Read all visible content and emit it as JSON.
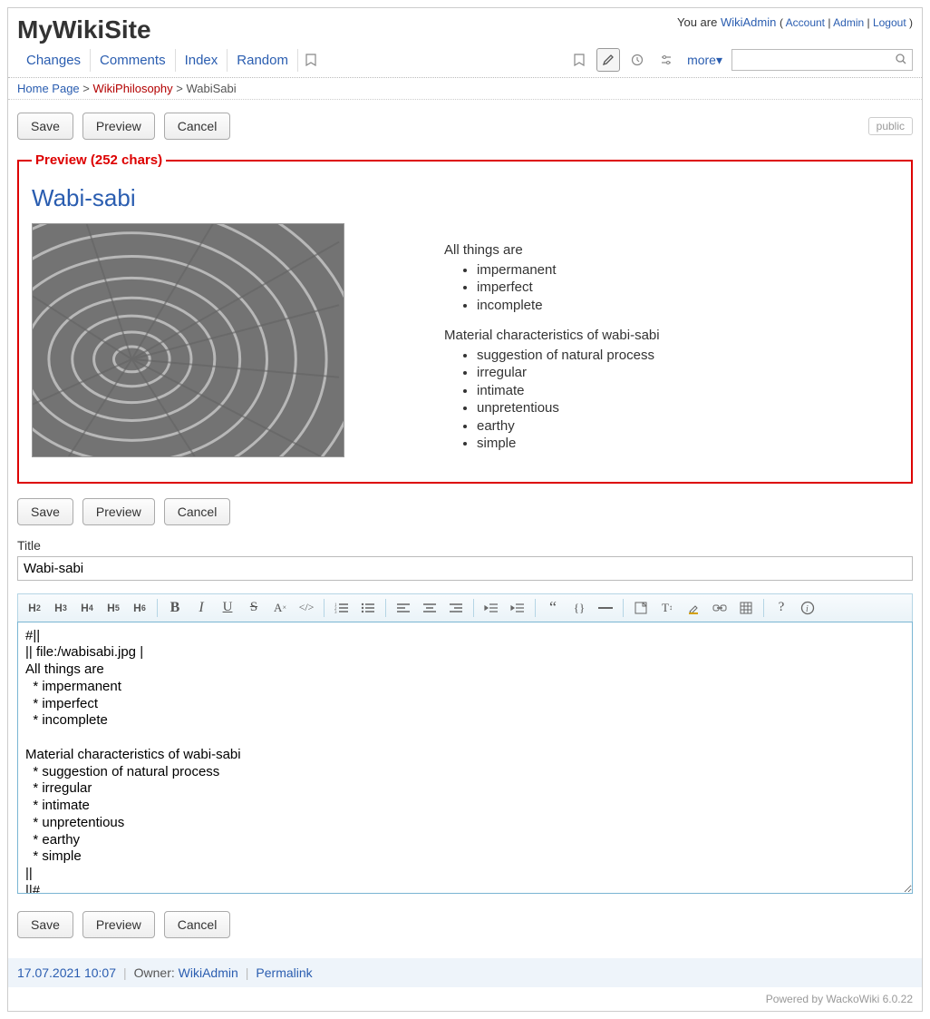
{
  "header": {
    "site_title": "MyWikiSite",
    "you_are": "You are ",
    "username": "WikiAdmin",
    "account": "Account",
    "admin": "Admin",
    "logout": "Logout"
  },
  "nav": {
    "changes": "Changes",
    "comments": "Comments",
    "index": "Index",
    "random": "Random",
    "more": "more▾"
  },
  "breadcrumb": {
    "home": "Home Page",
    "parent": "WikiPhilosophy",
    "current": "WabiSabi"
  },
  "buttons": {
    "save": "Save",
    "preview": "Preview",
    "cancel": "Cancel",
    "public": "public"
  },
  "preview": {
    "legend": "Preview (252 chars)",
    "title": "Wabi-sabi",
    "p1": "All things are",
    "l1": [
      "impermanent",
      "imperfect",
      "incomplete"
    ],
    "p2": "Material characteristics of wabi-sabi",
    "l2": [
      "suggestion of natural process",
      "irregular",
      "intimate",
      "unpretentious",
      "earthy",
      "simple"
    ]
  },
  "form": {
    "title_label": "Title",
    "title_value": "Wabi-sabi",
    "editor_value": "#||\n|| file:/wabisabi.jpg |\nAll things are\n  * impermanent\n  * imperfect\n  * incomplete\n\nMaterial characteristics of wabi-sabi\n  * suggestion of natural process\n  * irregular\n  * intimate\n  * unpretentious\n  * earthy\n  * simple\n||\n||#"
  },
  "footer": {
    "timestamp": "17.07.2021 10:07",
    "owner_label": "Owner: ",
    "owner": "WikiAdmin",
    "permalink": "Permalink",
    "powered": "Powered by WackoWiki 6.0.22"
  }
}
